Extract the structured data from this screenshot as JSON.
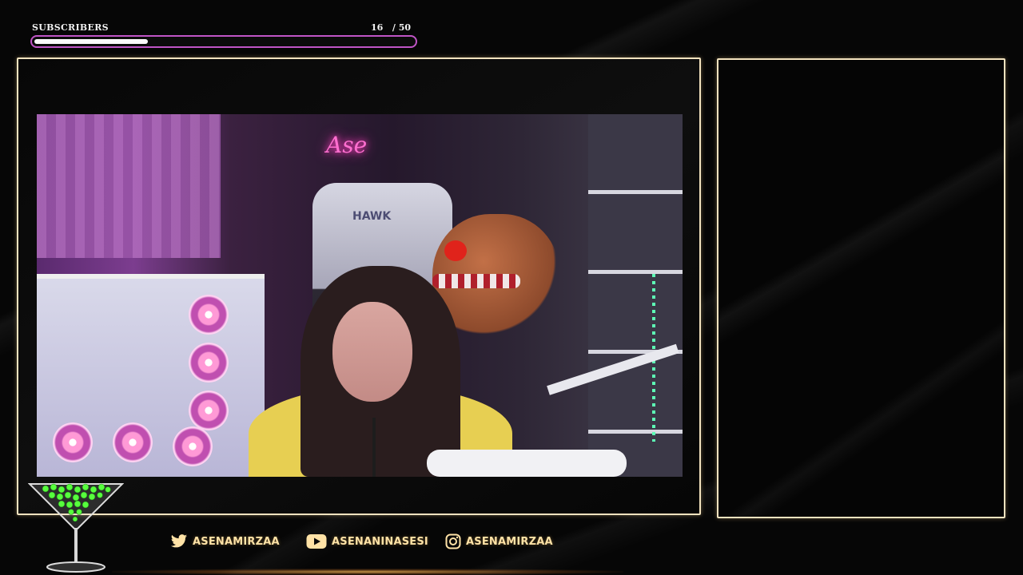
{
  "subscriber_goal": {
    "label": "SUBSCRIBERS",
    "current": "16",
    "separator": "/",
    "target": "50",
    "progress_fraction": 0.3
  },
  "webcam": {
    "neon_sign_text": "Ase",
    "chair_brand": "HAWK"
  },
  "socials": [
    {
      "platform_icon": "twitter-icon",
      "handle": "ASENAMIRZAA"
    },
    {
      "platform_icon": "youtube-icon",
      "handle": "ASENANINASESI"
    },
    {
      "platform_icon": "instagram-icon",
      "handle": "ASENAMIRZAA"
    }
  ],
  "colors": {
    "frame_border": "#f3e3bf",
    "progress_border": "#c055c6",
    "progress_fill": "#fafafa",
    "social_text": "#ffe2a6",
    "cocktail_accent": "#57ff3d"
  }
}
